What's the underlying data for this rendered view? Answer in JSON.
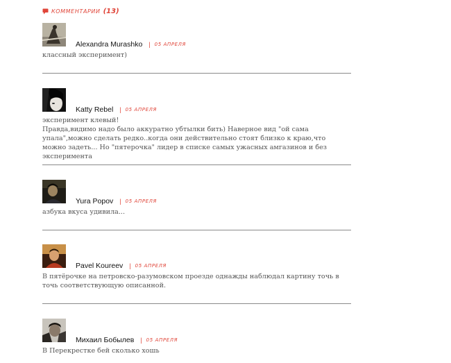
{
  "header": {
    "label": "комментарии",
    "count": "(13)",
    "icon": "speech-bubble-icon",
    "accent_color": "#e0463a"
  },
  "comments": [
    {
      "author": "Alexandra Murashko",
      "separator": "|",
      "date": "05 апреля",
      "text": [
        "классный эксперимент)"
      ],
      "avatar": "user-photo"
    },
    {
      "author": "Katty Rebel",
      "separator": "|",
      "date": "05 апреля",
      "text": [
        "эксперимент клевый!",
        "Правда,видимо надо было аккуратно убтылки бить) Наверное вид \"ой сама упала\",можно сделать редко..когда они действительно стоят близко к краю,что можно задеть... Но \"пятерочка\" лидер в списке самых ужасных амгазинов и без эксперимента"
      ],
      "avatar": "user-photo"
    },
    {
      "author": "Yura Popov",
      "separator": "|",
      "date": "05 апреля",
      "text": [
        "азбука вкуса удивила..."
      ],
      "avatar": "user-photo"
    },
    {
      "author": "Pavel Koureev",
      "separator": "|",
      "date": "05 апреля",
      "text": [
        "В пятёрочке на петровско-разумовском проезде однажды наблюдал картину точь в точь соответствующую описанной."
      ],
      "avatar": "user-photo"
    },
    {
      "author": "Михаил Бобылев",
      "separator": "|",
      "date": "05 апреля",
      "text": [
        "В Перекрестке бей сколько хошь"
      ],
      "avatar": "user-photo"
    }
  ]
}
